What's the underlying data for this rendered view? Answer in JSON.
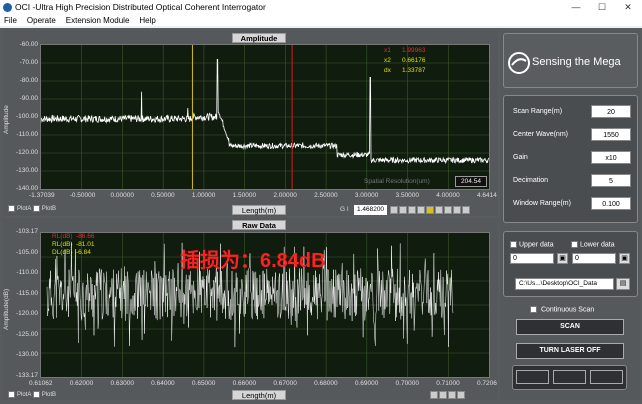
{
  "window": {
    "title": "OCI -Ultra High Precision Distributed Optical Coherent Interrogator",
    "min": "—",
    "max": "☐",
    "close": "✕"
  },
  "menu": [
    "File",
    "Operate",
    "Extension Module",
    "Help"
  ],
  "amplitude_plot": {
    "title": "Amplitude",
    "ylabel": "Amplitude",
    "xlabel": "Length(m)",
    "yticks": [
      "-60.00",
      "-70.00",
      "-80.00",
      "-90.00",
      "-100.00",
      "-110.00",
      "-120.00",
      "-130.00",
      "-140.00"
    ],
    "xticks": [
      "-1.37039",
      "-0.50000",
      "0.00000",
      "0.50000",
      "1.00000",
      "1.50000",
      "2.00000",
      "2.50000",
      "3.00000",
      "3.50000",
      "4.00000",
      "4.6414"
    ],
    "cursor_readouts": [
      {
        "label": "x1",
        "value": "1.99963",
        "color": "#e03030"
      },
      {
        "label": "x2",
        "value": "0.66176",
        "color": "#e0e000"
      },
      {
        "label": "dx",
        "value": "1.33787",
        "color": "#e0e000"
      }
    ],
    "spatial_resolution_label": "Spatial Resolution(um)",
    "spatial_resolution_value": "204.54",
    "gi_label": "G I",
    "gi_value": "1.468200",
    "legend": {
      "plot_a": "PlotA",
      "plot_b": "PlotB"
    }
  },
  "raw_plot": {
    "title": "Raw Data",
    "ylabel": "Amplitude(dB)",
    "xlabel": "Length(m)",
    "yticks": [
      "-103.17",
      "-105.00",
      "-110.00",
      "-115.00",
      "-120.00",
      "-125.00",
      "-130.00",
      "-133.17"
    ],
    "xticks": [
      "0.61062",
      "0.62000",
      "0.63000",
      "0.64000",
      "0.65000",
      "0.66000",
      "0.67000",
      "0.68000",
      "0.69000",
      "0.70000",
      "0.71000",
      "0.7206"
    ],
    "readouts": [
      {
        "label": "RL(dB)",
        "value": "-86.66",
        "color": "#e03030"
      },
      {
        "label": "RL(dB)",
        "value": "-81.01",
        "color": "#e0e000"
      },
      {
        "label": "DL(dB)",
        "value": "-6.84",
        "color": "#e0e000"
      }
    ],
    "overlay_text": "插损为：6.84dB",
    "legend": {
      "plot_a": "PlotA",
      "plot_b": "PlotB"
    }
  },
  "logo": "Sensing the Mega",
  "params": [
    {
      "label": "Scan Range(m)",
      "value": "20"
    },
    {
      "label": "Center Wave(nm)",
      "value": "1550"
    },
    {
      "label": "Gain",
      "value": "x10"
    },
    {
      "label": "Decimation",
      "value": "5"
    },
    {
      "label": "Window Range(m)",
      "value": "0.100"
    }
  ],
  "upper_data_label": "Upper data",
  "lower_data_label": "Lower data",
  "upper_data_value": "0",
  "lower_data_value": "0",
  "path": "C:\\Us...\\Desktop\\OCI_Data",
  "continuous_scan_label": "Continuous Scan",
  "scan_button": "SCAN",
  "laser_button": "TURN LASER OFF",
  "colors": {
    "trace": "#ffffff",
    "grid": "#3d5a2e",
    "cursor_red": "#d02020",
    "cursor_yellow": "#d8c020",
    "overlay": "#ff2020"
  }
}
